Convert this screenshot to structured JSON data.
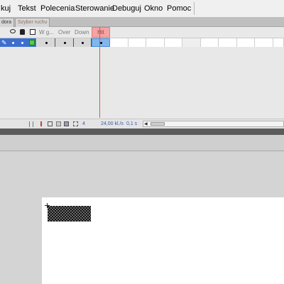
{
  "menu": {
    "items": [
      "kuj",
      "Tekst",
      "Polecenia",
      "Sterowanie",
      "Debuguj",
      "Okno",
      "Pomoc"
    ]
  },
  "tabs": [
    "dora",
    "Szybor ruchu"
  ],
  "timeline": {
    "frame_labels": [
      "W g...",
      "Over",
      "Down"
    ],
    "hit_label": "Hit",
    "current_frame": "4",
    "fps": "24,00 kl./s",
    "time": "0,1 s"
  },
  "colors": {
    "hit_header": "#f5a3a3",
    "playhead": "#e05454",
    "selected_frame": "#7fb6ee",
    "layer_color_box": "#4fd14f"
  }
}
